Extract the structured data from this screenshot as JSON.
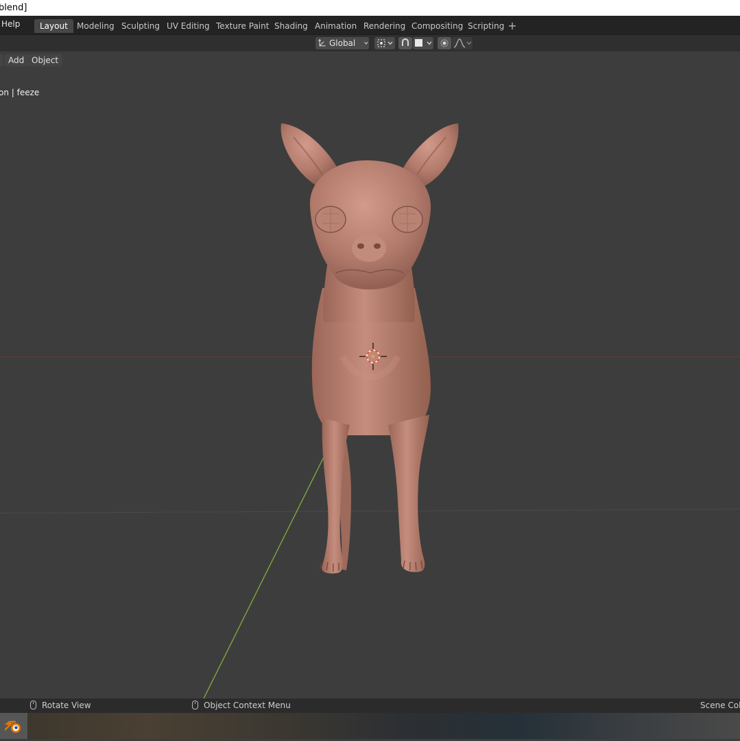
{
  "window": {
    "title_fragment": "blend]"
  },
  "topbar": {
    "help_label": "Help",
    "tabs": [
      {
        "label": "Layout",
        "active": true
      },
      {
        "label": "Modeling"
      },
      {
        "label": "Sculpting"
      },
      {
        "label": "UV Editing"
      },
      {
        "label": "Texture Paint"
      },
      {
        "label": "Shading"
      },
      {
        "label": "Animation"
      },
      {
        "label": "Rendering"
      },
      {
        "label": "Compositing"
      },
      {
        "label": "Scripting"
      }
    ],
    "add_tab_label": "+"
  },
  "header": {
    "orientation_label": "Global",
    "icons": [
      "transform-orientation-icon",
      "pivot-point-icon",
      "snap-icon",
      "snap-target-icon",
      "proportional-edit-icon",
      "falloff-icon"
    ]
  },
  "viewport": {
    "menu_add": "Add",
    "menu_object": "Object",
    "overlay_text": "on | feeze"
  },
  "statusbar": {
    "rotate_view": "Rotate View",
    "context_menu": "Object Context Menu",
    "scene_collection": "Scene Colle"
  },
  "colors": {
    "accent": "#4772b3",
    "model_skin": "#b88274",
    "background": "#3d3d3d",
    "x_axis": "#8a4242",
    "y_axis": "#7ea83d"
  }
}
